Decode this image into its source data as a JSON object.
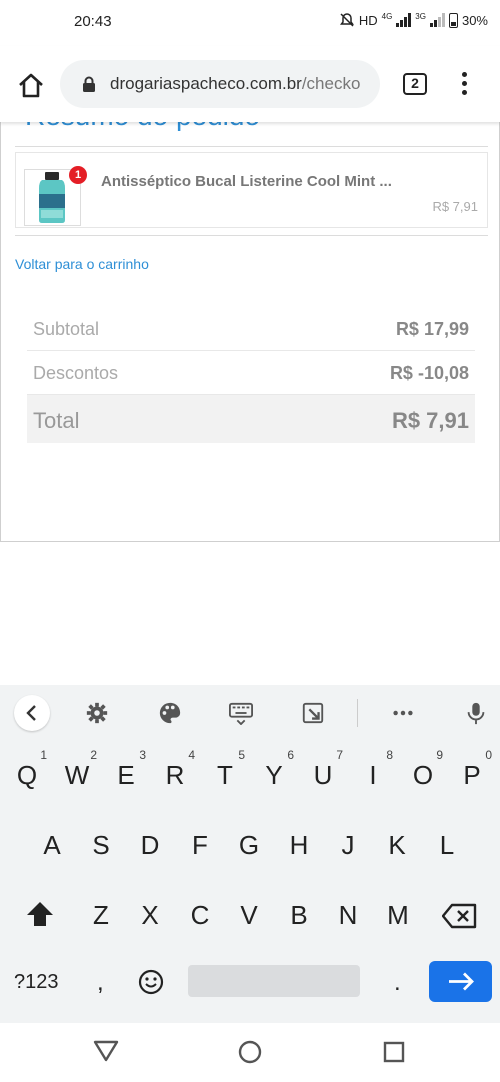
{
  "status_bar": {
    "time": "20:43",
    "network": "HD",
    "net1": "4G",
    "net2": "3G",
    "battery": "30%"
  },
  "browser": {
    "url_domain": "drogariaspacheco.com.br",
    "url_path": "/checko",
    "tab_count": "2"
  },
  "page": {
    "section_title": "Resumo do pedido",
    "item": {
      "quantity": "1",
      "name": "Antisséptico Bucal Listerine Cool Mint ...",
      "price": "R$ 7,91"
    },
    "back_link": "Voltar para o carrinho",
    "totals": {
      "subtotal_label": "Subtotal",
      "subtotal_value": "R$ 17,99",
      "discount_label": "Descontos",
      "discount_value": "R$ -10,08",
      "total_label": "Total",
      "total_value": "R$ 7,91"
    }
  },
  "keyboard": {
    "row1": [
      "Q",
      "W",
      "E",
      "R",
      "T",
      "Y",
      "U",
      "I",
      "O",
      "P"
    ],
    "row1_digits": [
      "1",
      "2",
      "3",
      "4",
      "5",
      "6",
      "7",
      "8",
      "9",
      "0"
    ],
    "row2": [
      "A",
      "S",
      "D",
      "F",
      "G",
      "H",
      "J",
      "K",
      "L"
    ],
    "row3": [
      "Z",
      "X",
      "C",
      "V",
      "B",
      "N",
      "M"
    ],
    "symbols_key": "?123",
    "comma_key": ",",
    "period_key": "."
  },
  "colors": {
    "accent": "#2e8fd6",
    "badge": "#e41e26",
    "enter_key": "#1a73e8"
  }
}
